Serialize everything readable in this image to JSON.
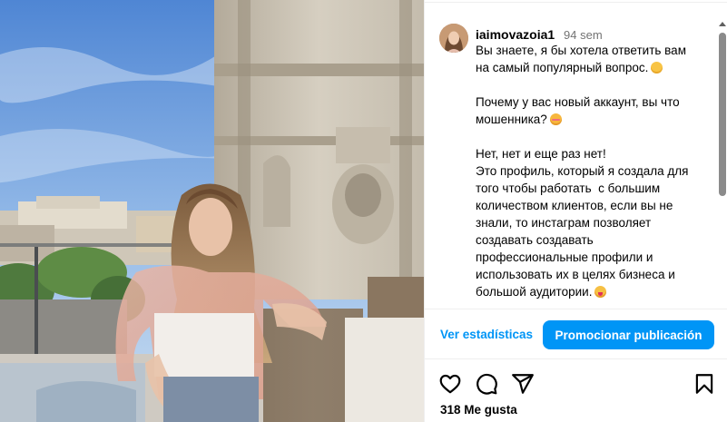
{
  "post": {
    "author": {
      "username": "iaimovazoia1",
      "time_ago": "94 sem"
    },
    "caption": {
      "line1": "Вы знаете, я бы хотела ответить вам на самый популярный вопрос.",
      "line2": "Почему у вас новый аккаунт, вы что мошенника?",
      "line3": "Нет, нет и еще раз нет!\nЭто профиль, который я создала для того чтобы работать  с большим количеством клиентов, если вы не знали, то инстаграм позволяет создавать создавать профессиональные профили и использовать их в целях бизнеса и большой аудитории."
    },
    "emojis": [
      "smirk",
      "flushed",
      "tongue"
    ],
    "promo": {
      "stats_label": "Ver estadísticas",
      "promote_label": "Promocionar publicación"
    },
    "actions": [
      "heart-icon",
      "comment-icon",
      "share-icon",
      "bookmark-icon"
    ],
    "likes_label": "318 Me gusta"
  },
  "colors": {
    "accent": "#0095f6",
    "muted_text": "#737373",
    "divider": "#efefef"
  }
}
